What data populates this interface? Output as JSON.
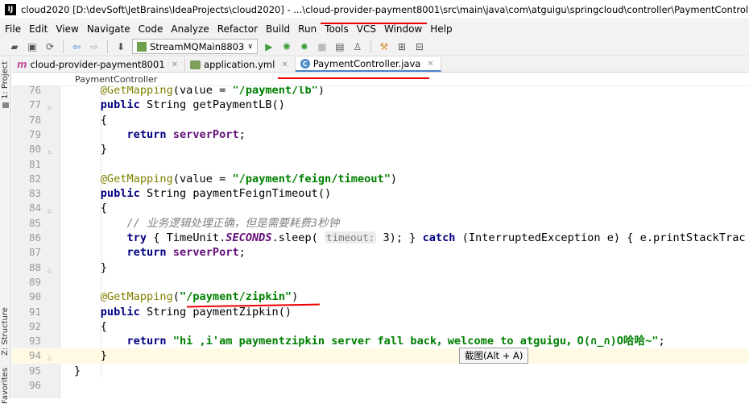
{
  "window": {
    "icon_text": "IJ",
    "title": "cloud2020 [D:\\devSoft\\JetBrains\\IdeaProjects\\cloud2020] - ...\\cloud-provider-payment8001\\src\\main\\java\\com\\atguigu\\springcloud\\controller\\PaymentController.java [cloud-provider-pa"
  },
  "menu": [
    "File",
    "Edit",
    "View",
    "Navigate",
    "Code",
    "Analyze",
    "Refactor",
    "Build",
    "Run",
    "Tools",
    "VCS",
    "Window",
    "Help"
  ],
  "toolbar": {
    "run_config": "StreamMQMain8803"
  },
  "sidebar": {
    "project": "1: Project",
    "structure": "Z: Structure",
    "favorites": "Favorites"
  },
  "tabs": [
    {
      "label": "cloud-provider-payment8001",
      "icon": "m-module-icon"
    },
    {
      "label": "application.yml",
      "icon": "yaml-icon"
    },
    {
      "label": "PaymentController.java",
      "icon": "class-icon",
      "active": true
    }
  ],
  "breadcrumb": "PaymentController",
  "code_lines": [
    {
      "n": "76",
      "html": "    <span class=\"an\">@GetMapping</span>(value = <span class=\"str\">\"/payment/lb\"</span>)"
    },
    {
      "n": "77",
      "html": "    <span class=\"kw\">public</span> String getPaymentLB()"
    },
    {
      "n": "78",
      "html": "    {"
    },
    {
      "n": "79",
      "html": "        <span class=\"kw\">return</span> <span class=\"fld\">serverPort</span>;"
    },
    {
      "n": "80",
      "html": "    }"
    },
    {
      "n": "81",
      "html": ""
    },
    {
      "n": "82",
      "html": "    <span class=\"an\">@GetMapping</span>(value = <span class=\"str\">\"/payment/feign/timeout\"</span>)"
    },
    {
      "n": "83",
      "html": "    <span class=\"kw\">public</span> String paymentFeignTimeout()"
    },
    {
      "n": "84",
      "html": "    {"
    },
    {
      "n": "85",
      "html": "        <span class=\"cm\">// 业务逻辑处理正确，但是需要耗费3秒钟</span>"
    },
    {
      "n": "86",
      "html": "        <span class=\"kw\">try</span> { TimeUnit.<span class=\"fld\" style=\"font-style:italic\">SECONDS</span>.sleep( <span class=\"hint\">timeout:</span> 3); } <span class=\"kw\">catch</span> (InterruptedException e) { e.printStackTrac"
    },
    {
      "n": "87",
      "html": "        <span class=\"kw\">return</span> <span class=\"fld\">serverPort</span>;"
    },
    {
      "n": "88",
      "html": "    }"
    },
    {
      "n": "89",
      "html": ""
    },
    {
      "n": "90",
      "html": "    <span class=\"an\">@GetMapping</span>(<span class=\"str\">\"/payment/zipkin\"</span>)"
    },
    {
      "n": "91",
      "html": "    <span class=\"kw\">public</span> String paymentZipkin()"
    },
    {
      "n": "92",
      "html": "    {"
    },
    {
      "n": "93",
      "html": "        <span class=\"kw\">return</span> <span class=\"str\">\"hi ,i'am paymentzipkin server fall back，welcome to atguigu，O(∩_∩)O哈哈~\"</span>;"
    },
    {
      "n": "94",
      "html": "    }"
    },
    {
      "n": "95",
      "html": "}"
    },
    {
      "n": "96",
      "html": ""
    }
  ],
  "tooltip": "截图(Alt + A)"
}
